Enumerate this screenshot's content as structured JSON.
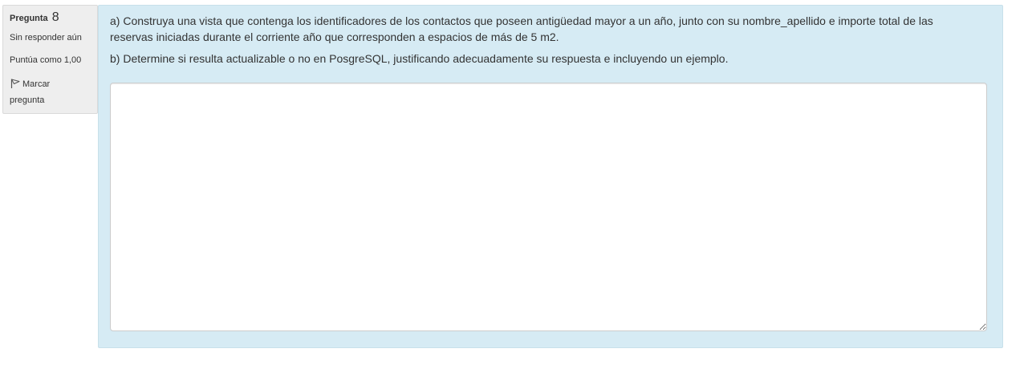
{
  "question_info": {
    "label": "Pregunta",
    "number": "8",
    "state": "Sin responder aún",
    "grade": "Puntúa como 1,00",
    "flag_label": "Marcar pregunta"
  },
  "question": {
    "part_a": "a) Construya una vista que contenga los identificadores de los contactos que poseen antigüedad mayor a un año, junto con su nombre_apellido e importe total de las reservas iniciadas durante el corriente año que corresponden a espacios de más de 5 m2.",
    "part_b": "b) Determine si resulta actualizable o no en PosgreSQL, justificando adecuadamente su respuesta e incluyendo un ejemplo.",
    "answer_value": ""
  },
  "icons": {
    "flag": "flag-icon"
  },
  "colors": {
    "content_background": "#d6ebf4",
    "info_background": "#eeeeee"
  }
}
